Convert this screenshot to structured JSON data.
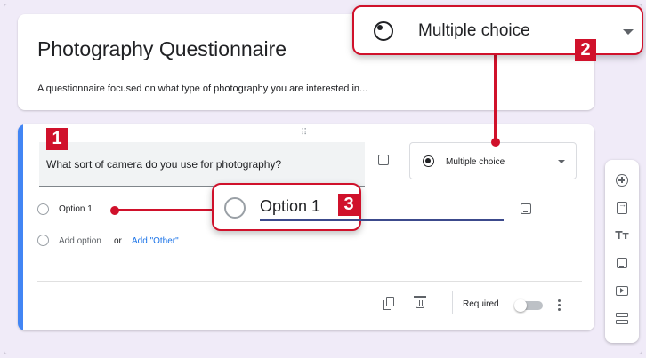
{
  "form": {
    "title": "Photography Questionnaire",
    "description": "A questionnaire focused on what type of photography you are interested in..."
  },
  "question": {
    "text": "What sort of camera do you use for photography?",
    "type_label": "Multiple choice",
    "options": [
      "Option 1"
    ],
    "add_option_label": "Add option",
    "or_label": "or",
    "add_other_label": "Add \"Other\"",
    "required_label": "Required",
    "required_on": false
  },
  "callouts": {
    "type_zoom_label": "Multiple choice",
    "option_zoom_label": "Option 1",
    "badge1": "1",
    "badge2": "2",
    "badge3": "3"
  },
  "toolbar": {
    "tt_label": "Tт",
    "icons": [
      "add-question-icon",
      "import-questions-icon",
      "add-title-icon",
      "add-image-icon",
      "add-video-icon",
      "add-section-icon"
    ]
  },
  "colors": {
    "accent": "#4285f4",
    "annotation_red": "#d0112b",
    "background": "#f0ebf8"
  }
}
